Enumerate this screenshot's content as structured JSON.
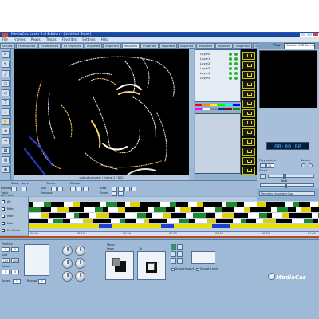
{
  "window": {
    "title": "MediaCas Laser 2.0 Edition - [Untitled Show]"
  },
  "menu": [
    "File",
    "Frames",
    "Pages",
    "Tracks",
    "Favorites",
    "Settings",
    "Help"
  ],
  "page_tabs": [
    {
      "label": "Visuals",
      "active": false
    },
    {
      "label": "Fx Imported",
      "active": false
    },
    {
      "label": "Fx Imported",
      "active": false
    },
    {
      "label": "Fx Imported",
      "active": false
    },
    {
      "label": "Imported",
      "active": false
    },
    {
      "label": "Imported",
      "active": false
    },
    {
      "label": "Imported",
      "active": true
    },
    {
      "label": "Imported",
      "active": false
    },
    {
      "label": "Imported",
      "active": false
    },
    {
      "label": "Imported",
      "active": false
    },
    {
      "label": "Imported",
      "active": false
    },
    {
      "label": "Imported",
      "active": false
    },
    {
      "label": "Imported",
      "active": false
    },
    {
      "label": "Imported",
      "active": false
    },
    {
      "label": "Imported",
      "active": false
    },
    {
      "label": "Imported",
      "active": false
    }
  ],
  "view": {
    "label": "View",
    "selected": "Medialas USB Box rdr"
  },
  "left_tools": [
    {
      "icon": "pointer-icon",
      "glyph": "↖"
    },
    {
      "icon": "pen-icon",
      "glyph": "✎"
    },
    {
      "icon": "line-icon",
      "glyph": "╱"
    },
    {
      "icon": "rect-icon",
      "glyph": "▭"
    },
    {
      "icon": "circle-icon",
      "glyph": "○"
    },
    {
      "icon": "text-icon",
      "glyph": "T"
    },
    {
      "icon": "zoom-icon",
      "glyph": "⌕"
    },
    {
      "icon": "hand-icon",
      "glyph": "✋"
    },
    {
      "icon": "rotate-icon",
      "glyph": "⟲"
    },
    {
      "icon": "mirror-icon",
      "glyph": "⇋"
    },
    {
      "icon": "grid-icon",
      "glyph": "▦"
    },
    {
      "icon": "fill-icon",
      "glyph": "▨"
    },
    {
      "icon": "eye-icon",
      "glyph": "◉"
    }
  ],
  "canvas": {
    "status": "output preview | frame 1 / 800"
  },
  "layers": [
    "Layer0",
    "Layer1",
    "Layer2",
    "Layer3",
    "Layer4",
    "Layer5"
  ],
  "palette_colors": [
    "#ff0000",
    "#ff8800",
    "#ffff00",
    "#00ff00",
    "#00ffff",
    "#0000ff",
    "#ff00ff",
    "#ffffff",
    "#888888",
    "#003399",
    "#990000",
    "#009900"
  ],
  "right_panel": {
    "timecode": "00:00:00",
    "play_control_label": "Play control",
    "source_label": "Source",
    "fps_value": "25",
    "scroll_label": "Scroll",
    "fade_label": "Fade",
    "clip_name": "Medialas_Imported(Cap)"
  },
  "timeline_header": {
    "show_label": "Show",
    "save_label": "Save",
    "tracks_label": "Tracks",
    "effects_label": "Effects",
    "frames_label": "Frames",
    "track_label": "Track",
    "add_label": "Add",
    "remove_label": "Remove",
    "view_label": "View",
    "zoom_label": "Zoom",
    "section_label": "All Tracks"
  },
  "tracks": [
    {
      "name": "All",
      "checked": true
    },
    {
      "name": "Main",
      "checked": true
    },
    {
      "name": "Main",
      "checked": true
    },
    {
      "name": "Main",
      "checked": true
    },
    {
      "name": "2 effects",
      "checked": true
    }
  ],
  "ruler": [
    "00:00",
    "00:10",
    "00:20",
    "00:30",
    "00:40",
    "00:50",
    "01:00"
  ],
  "bottom": {
    "position_label": "Position",
    "size_label": "Size",
    "rotate_label": "Rotate",
    "speed_label": "Speed",
    "repeat_label": "Repeat",
    "move_label": "Move",
    "from_label": "From",
    "to_label": "To",
    "smooth_start": "Smooth start",
    "smooth_end": "Smooth end",
    "spinner_values": [
      "0",
      "0",
      "100",
      "100",
      "0",
      "0",
      "1",
      "0"
    ]
  },
  "brand": "MediaCas"
}
